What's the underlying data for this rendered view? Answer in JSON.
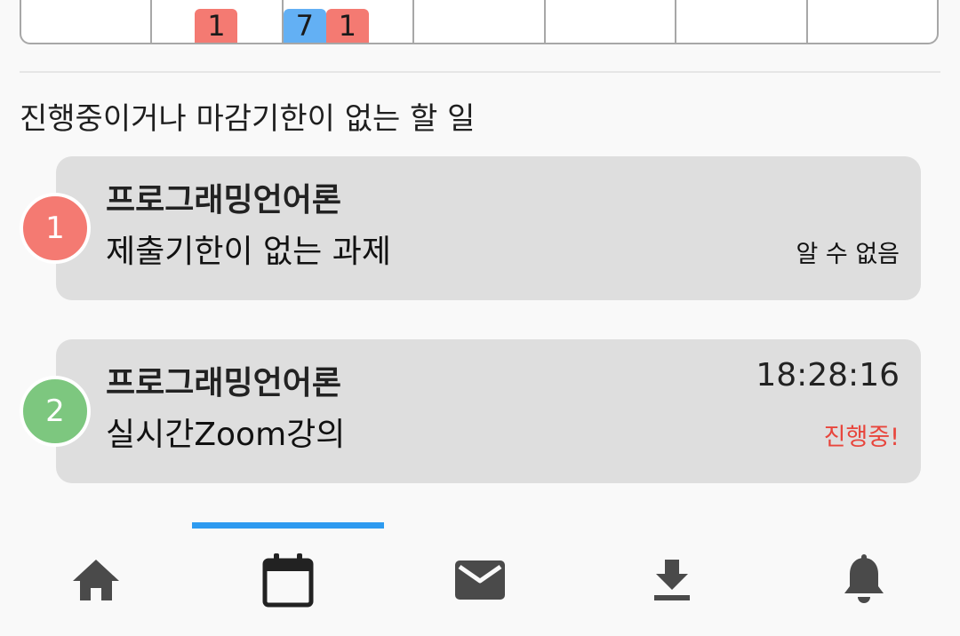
{
  "calendar_row": {
    "badges": [
      {
        "cell": 1,
        "items": [
          {
            "text": "1",
            "color": "#f47a72"
          }
        ]
      },
      {
        "cell": 2,
        "items": [
          {
            "text": "7",
            "color": "#63b0f4"
          },
          {
            "text": "1",
            "color": "#f47a72"
          }
        ]
      }
    ]
  },
  "section": {
    "title": "진행중이거나 마감기한이 없는 할 일"
  },
  "tasks": [
    {
      "number": "1",
      "course": "프로그래밍언어론",
      "title": "제출기한이 없는 과제",
      "time": "",
      "status": "알 수 없음",
      "status_color": "#111111",
      "circle_color": "#f47a72"
    },
    {
      "number": "2",
      "course": "프로그래밍언어론",
      "title": "실시간Zoom강의",
      "time": "18:28:16",
      "status": "진행중!",
      "status_color": "#e8453c",
      "circle_color": "#7dc77f"
    }
  ],
  "bottom_nav": {
    "items": [
      {
        "icon": "home-icon"
      },
      {
        "icon": "calendar-icon",
        "active": true
      },
      {
        "icon": "mail-icon"
      },
      {
        "icon": "download-icon"
      },
      {
        "icon": "bell-icon"
      }
    ],
    "active_color": "#2d9bf0",
    "icon_color": "#4a4a4a"
  }
}
